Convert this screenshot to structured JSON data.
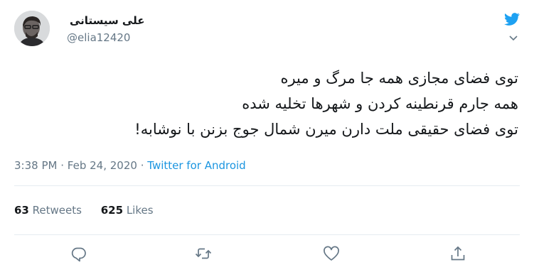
{
  "author": {
    "name": "علی سیستانی",
    "handle": "@elia12420"
  },
  "tweet": {
    "lines": [
      "توی فضای مجازی همه جا مرگ و میره",
      "همه جارم قرنطینه کردن و شهرها تخلیه شده",
      "توی فضای حقیقی ملت دارن میرن شمال جوج بزنن با نوشابه!"
    ],
    "time": "3:38 PM",
    "sep1": "·",
    "date": "Feb 24, 2020",
    "sep2": "·",
    "source": "Twitter for Android"
  },
  "stats": {
    "retweets_count": "63",
    "retweets_label": "Retweets",
    "likes_count": "625",
    "likes_label": "Likes"
  },
  "icons": {
    "logo": "twitter-bird-icon",
    "menu": "chevron-down-icon",
    "reply": "reply-icon",
    "retweet": "retweet-icon",
    "like": "heart-icon",
    "share": "share-icon"
  },
  "colors": {
    "brand": "#1da1f2",
    "link": "#1b95e0",
    "muted": "#657786",
    "text": "#14171a"
  }
}
